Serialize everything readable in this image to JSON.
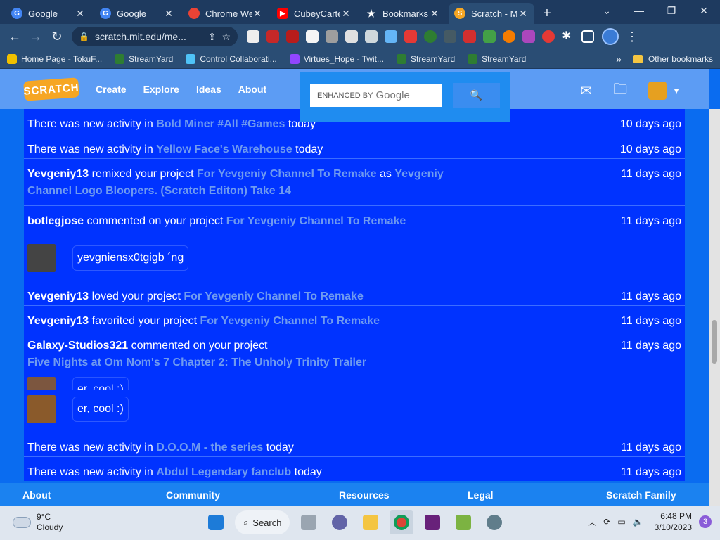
{
  "browser": {
    "tabs": [
      {
        "title": "Google",
        "favicon": "google-icon",
        "color": "#4285f4",
        "active": false
      },
      {
        "title": "Google",
        "favicon": "google-icon",
        "color": "#4285f4",
        "active": false
      },
      {
        "title": "Chrome We",
        "favicon": "chrome-webstore-icon",
        "color": "#ea4335",
        "active": false
      },
      {
        "title": "CubeyCarte",
        "favicon": "youtube-icon",
        "color": "#ff0000",
        "active": false
      },
      {
        "title": "Bookmarks",
        "favicon": "star-icon",
        "color": "#ffffff",
        "active": false
      },
      {
        "title": "Scratch - M",
        "favicon": "scratch-icon",
        "color": "#f6a623",
        "active": true
      }
    ],
    "url": "scratch.mit.edu/me...",
    "bookmarks": [
      {
        "label": "Home Page - TokuF...",
        "color": "#f0c000"
      },
      {
        "label": "StreamYard",
        "color": "#2e7d32"
      },
      {
        "label": "Control Collaborati...",
        "color": "#4fc3f7"
      },
      {
        "label": "Virtues_Hope - Twit...",
        "color": "#9146ff"
      },
      {
        "label": "StreamYard",
        "color": "#2e7d32"
      },
      {
        "label": "StreamYard",
        "color": "#2e7d32"
      }
    ],
    "bookmarks_more": "»",
    "other_bookmarks": "Other bookmarks"
  },
  "scratch": {
    "nav": {
      "logo": "SCRATCH",
      "create": "Create",
      "explore": "Explore",
      "ideas": "Ideas",
      "about": "About"
    },
    "search": {
      "enhanced": "ENHANCED BY",
      "google": "Google"
    },
    "feed": [
      {
        "type": "activity",
        "pre": "There was new activity in",
        "link": "Bold Miner #All #Games",
        "post": "today",
        "ago": "10 days ago"
      },
      {
        "type": "activity",
        "pre": "There was new activity in",
        "link": "Yellow Face's Warehouse",
        "post": "today",
        "ago": "10 days ago"
      },
      {
        "type": "remix",
        "user": "Yevgeniy13",
        "pre": "remixed your project",
        "link": "For Yevgeniy Channel To Remake",
        "mid": "as",
        "link2": "Yevgeniy Channel Logo Bloopers. (Scratch Editon) Take 14",
        "ago": "11 days ago"
      },
      {
        "type": "comment",
        "user": "botlegjose",
        "pre": "commented on your project",
        "link": "For Yevgeniy Channel To Remake",
        "comment": "yevgniensx0tgigb ´ng",
        "ago": "11 days ago"
      },
      {
        "type": "loved",
        "user": "Yevgeniy13",
        "pre": "loved your project",
        "link": "For Yevgeniy Channel To Remake",
        "ago": "11 days ago"
      },
      {
        "type": "favorited",
        "user": "Yevgeniy13",
        "pre": "favorited your project",
        "link": "For Yevgeniy Channel To Remake",
        "ago": "11 days ago"
      },
      {
        "type": "comment2",
        "user": "Galaxy-Studios321",
        "pre": "commented on your project",
        "link": "Five Nights at Om Nom's 7 Chapter 2: The Unholy Trinity Trailer",
        "comment": "er, cool :)",
        "ago": "11 days ago"
      },
      {
        "type": "activity",
        "pre": "There was new activity in",
        "link": "D.O.O.M - the series",
        "post": "today",
        "ago": "11 days ago"
      },
      {
        "type": "activity",
        "pre": "There was new activity in",
        "link": "Abdul Legendary fanclub",
        "post": "today",
        "ago": "11 days ago"
      }
    ],
    "footer": {
      "about": "About",
      "community": "Community",
      "resources": "Resources",
      "legal": "Legal",
      "family": "Scratch Family"
    }
  },
  "taskbar": {
    "temp": "9°C",
    "weather": "Cloudy",
    "search": "Search",
    "time": "6:48 PM",
    "date": "3/10/2023",
    "notifications": "3"
  }
}
